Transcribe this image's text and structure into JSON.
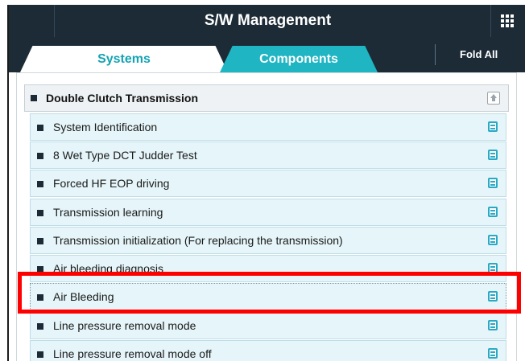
{
  "window": {
    "title": "S/W Management",
    "menu_icon": "grid-menu-icon"
  },
  "tabs": [
    {
      "label": "Systems",
      "active": true
    },
    {
      "label": "Components",
      "active": false
    }
  ],
  "fold_all_label": "Fold All",
  "group": {
    "title": "Double Clutch Transmission",
    "collapse_icon": "collapse-up-icon",
    "items": [
      {
        "label": "System Identification",
        "icon": "document-icon"
      },
      {
        "label": "8 Wet Type DCT Judder Test",
        "icon": "document-icon"
      },
      {
        "label": "Forced HF EOP driving",
        "icon": "document-icon"
      },
      {
        "label": "Transmission learning",
        "icon": "document-icon"
      },
      {
        "label": "Transmission initialization (For replacing the transmission)",
        "icon": "document-icon"
      },
      {
        "label": "Air bleeding diagnosis",
        "icon": "document-icon"
      },
      {
        "label": "Air Bleeding",
        "icon": "document-icon",
        "highlighted": true
      },
      {
        "label": "Line pressure removal mode",
        "icon": "document-icon"
      },
      {
        "label": "Line pressure removal mode off",
        "icon": "document-icon"
      }
    ]
  },
  "colors": {
    "titlebar": "#1d2b36",
    "active_tab_text": "#15a3b3",
    "inactive_tab_bg": "#1fb5c3",
    "item_bg": "#e5f5f9",
    "highlight": "#ff0000",
    "doc_icon": "#29a9c4"
  }
}
